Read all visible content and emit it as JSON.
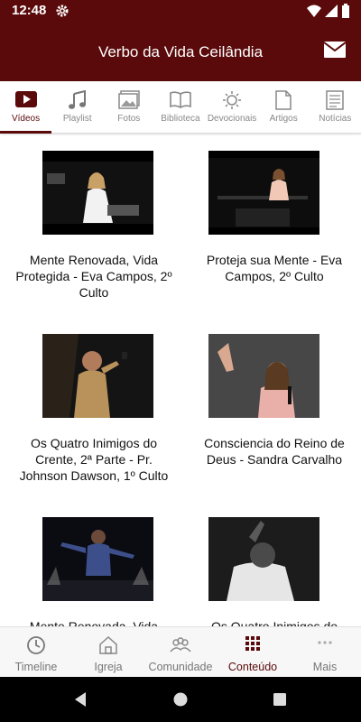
{
  "status": {
    "time": "12:48"
  },
  "app": {
    "title": "Verbo da Vida Ceilândia"
  },
  "tabs": [
    {
      "label": "Vídeos",
      "icon": "video-icon",
      "active": true
    },
    {
      "label": "Playlist",
      "icon": "music-note-icon"
    },
    {
      "label": "Fotos",
      "icon": "photos-icon"
    },
    {
      "label": "Biblioteca",
      "icon": "book-icon"
    },
    {
      "label": "Devocionais",
      "icon": "sun-icon"
    },
    {
      "label": "Artigos",
      "icon": "document-icon"
    },
    {
      "label": "Notícias",
      "icon": "news-icon"
    }
  ],
  "videos": [
    {
      "title": "Mente Renovada, Vida Protegida - Eva Campos, 2º Culto"
    },
    {
      "title": "Proteja sua Mente - Eva Campos, 2º Culto"
    },
    {
      "title": "Os Quatro Inimigos do Crente, 2ª Parte - Pr. Johnson Dawson, 1º Culto"
    },
    {
      "title": "Consciencia do Reino de Deus - Sandra Carvalho"
    },
    {
      "title": "Mente Renovada, Vida"
    },
    {
      "title": "Os Quatro Inimigos do"
    }
  ],
  "bottom_nav": [
    {
      "label": "Timeline",
      "icon": "clock-icon"
    },
    {
      "label": "Igreja",
      "icon": "church-icon"
    },
    {
      "label": "Comunidade",
      "icon": "community-icon"
    },
    {
      "label": "Conteúdo",
      "icon": "grid-icon",
      "active": true
    },
    {
      "label": "Mais",
      "icon": "more-icon"
    }
  ],
  "colors": {
    "primary": "#5a0a0a",
    "inactive": "#888888"
  }
}
